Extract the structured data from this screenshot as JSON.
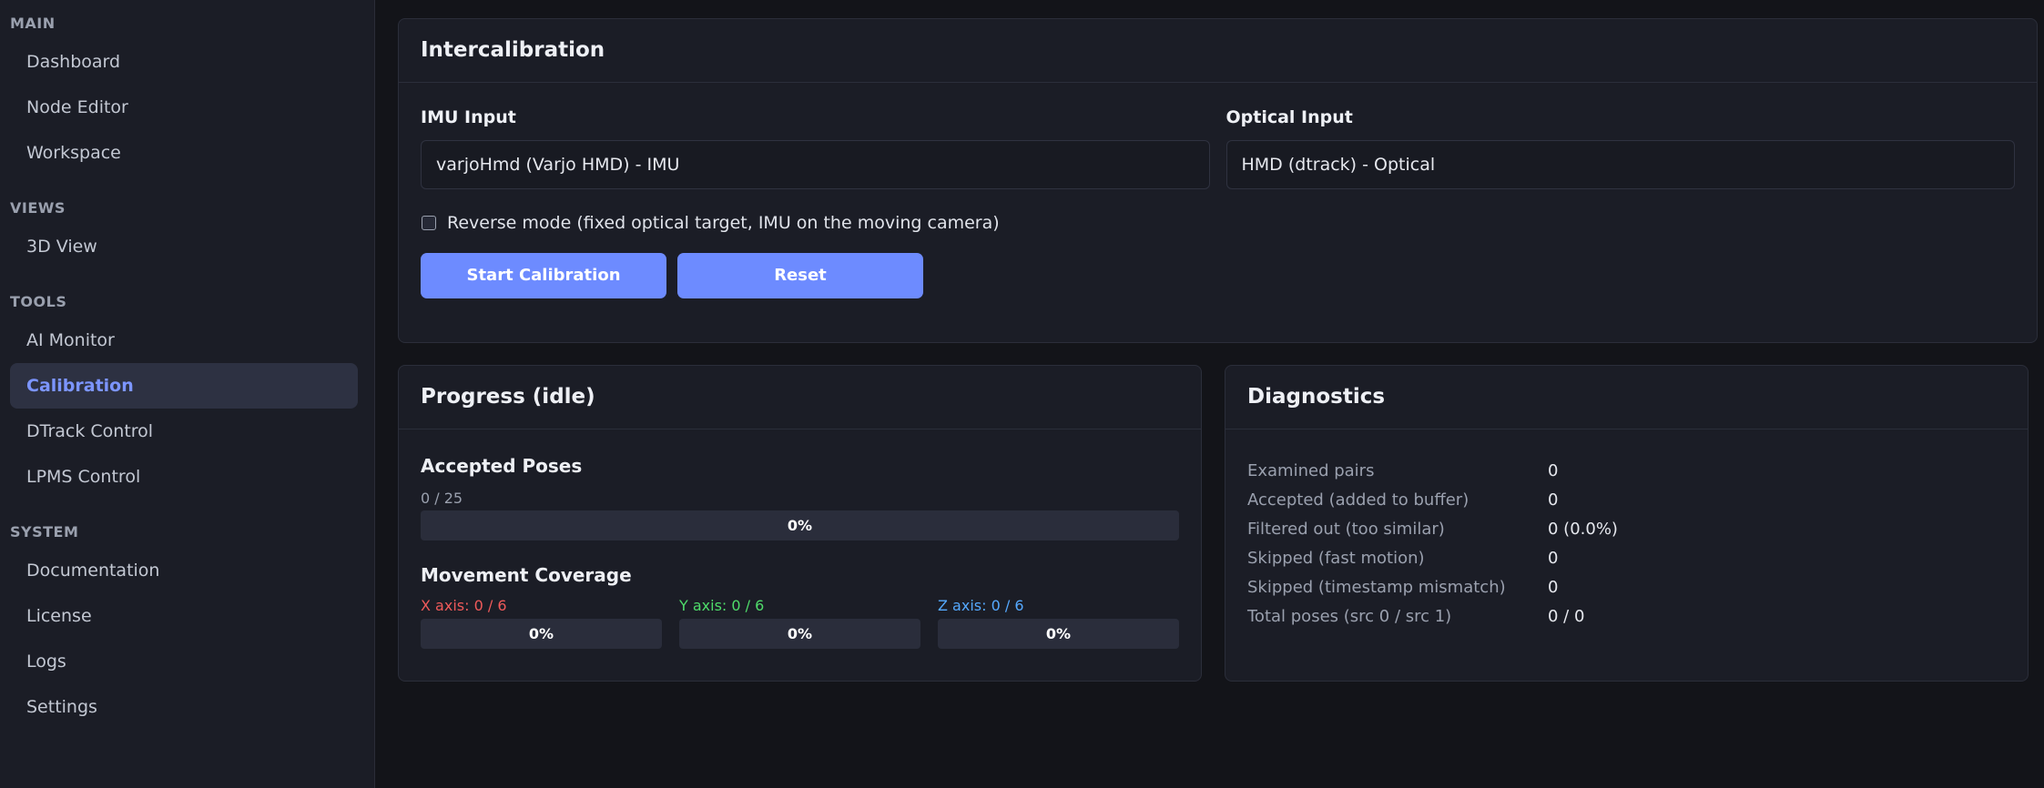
{
  "sidebar": {
    "sections": [
      {
        "title": "MAIN",
        "items": [
          "Dashboard",
          "Node Editor",
          "Workspace"
        ]
      },
      {
        "title": "VIEWS",
        "items": [
          "3D View"
        ]
      },
      {
        "title": "TOOLS",
        "items": [
          "AI Monitor",
          "Calibration",
          "DTrack Control",
          "LPMS Control"
        ]
      },
      {
        "title": "SYSTEM",
        "items": [
          "Documentation",
          "License",
          "Logs",
          "Settings"
        ]
      }
    ],
    "active_item": "Calibration"
  },
  "intercalibration": {
    "title": "Intercalibration",
    "imu_label": "IMU Input",
    "imu_value": "varjoHmd (Varjo HMD) - IMU",
    "optical_label": "Optical Input",
    "optical_value": "HMD (dtrack) - Optical",
    "reverse_mode_label": "Reverse mode (fixed optical target, IMU on the moving camera)",
    "reverse_mode_checked": false,
    "start_label": "Start Calibration",
    "reset_label": "Reset"
  },
  "progress": {
    "title": "Progress (idle)",
    "accepted_title": "Accepted Poses",
    "accepted_count": "0 / 25",
    "accepted_percent": "0%",
    "accepted_fraction": 0,
    "coverage_title": "Movement Coverage",
    "axes": [
      {
        "label": "X axis: 0 / 6",
        "percent": "0%",
        "fraction": 0,
        "color": "#f05a5a"
      },
      {
        "label": "Y axis: 0 / 6",
        "percent": "0%",
        "fraction": 0,
        "color": "#4fdc6a"
      },
      {
        "label": "Z axis: 0 / 6",
        "percent": "0%",
        "fraction": 0,
        "color": "#55a9ff"
      }
    ]
  },
  "diagnostics": {
    "title": "Diagnostics",
    "rows": [
      {
        "key": "Examined pairs",
        "value": "0"
      },
      {
        "key": "Accepted (added to buffer)",
        "value": "0"
      },
      {
        "key": "Filtered out (too similar)",
        "value": "0 (0.0%)"
      },
      {
        "key": "Skipped (fast motion)",
        "value": "0"
      },
      {
        "key": "Skipped (timestamp mismatch)",
        "value": "0"
      },
      {
        "key": "Total poses (src 0 / src 1)",
        "value": "0 / 0"
      }
    ]
  },
  "colors": {
    "accent": "#6d8bff",
    "background": "#131419",
    "panel": "#1b1d26"
  }
}
